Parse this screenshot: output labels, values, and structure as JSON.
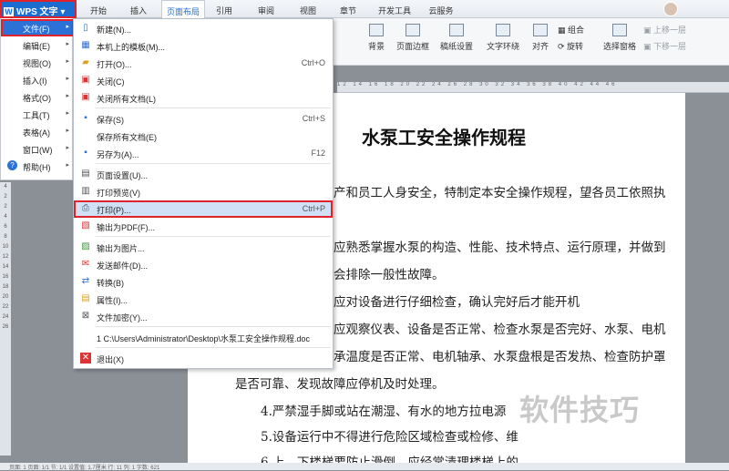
{
  "app": {
    "name": "WPS 文字"
  },
  "tabs": [
    "开始",
    "插入",
    "页面布局",
    "引用",
    "审阅",
    "视图",
    "章节",
    "开发工具",
    "云服务"
  ],
  "ribbon": {
    "big": [
      "背景",
      "页面边框",
      "稿纸设置",
      "文字环绕",
      "对齐",
      "旋转",
      "选择窗格"
    ],
    "small": [
      "组合",
      "上移一层",
      "下移一层"
    ]
  },
  "left_menu": [
    "文件(F)",
    "编辑(E)",
    "视图(O)",
    "插入(I)",
    "格式(O)",
    "工具(T)",
    "表格(A)",
    "窗口(W)",
    "帮助(H)"
  ],
  "file_menu": [
    {
      "label": "新建(N)...",
      "shortcut": "",
      "icon": "new-doc-icon"
    },
    {
      "label": "本机上的模板(M)...",
      "shortcut": "",
      "icon": "template-icon"
    },
    {
      "label": "打开(O)...",
      "shortcut": "Ctrl+O",
      "icon": "folder-open-icon"
    },
    {
      "label": "关闭(C)",
      "shortcut": "",
      "icon": "close-doc-icon"
    },
    {
      "label": "关闭所有文档(L)",
      "shortcut": "",
      "icon": "close-all-icon"
    },
    {
      "label": "保存(S)",
      "shortcut": "Ctrl+S",
      "icon": "save-icon"
    },
    {
      "label": "保存所有文档(E)",
      "shortcut": "",
      "icon": "save-all-icon"
    },
    {
      "label": "另存为(A)...",
      "shortcut": "F12",
      "icon": "save-as-icon"
    },
    {
      "label": "页面设置(U)...",
      "shortcut": "",
      "icon": "page-setup-icon"
    },
    {
      "label": "打印预览(V)",
      "shortcut": "",
      "icon": "print-preview-icon"
    },
    {
      "label": "打印(P)...",
      "shortcut": "Ctrl+P",
      "icon": "printer-icon"
    },
    {
      "label": "输出为PDF(F)...",
      "shortcut": "",
      "icon": "pdf-icon"
    },
    {
      "label": "输出为图片...",
      "shortcut": "",
      "icon": "image-export-icon"
    },
    {
      "label": "发送邮件(D)...",
      "shortcut": "",
      "icon": "mail-icon"
    },
    {
      "label": "转换(B)",
      "shortcut": "",
      "icon": "convert-icon"
    },
    {
      "label": "属性(I)...",
      "shortcut": "",
      "icon": "properties-icon"
    },
    {
      "label": "文件加密(Y)...",
      "shortcut": "",
      "icon": "encrypt-icon"
    },
    {
      "label": "1 C:\\Users\\Administrator\\Desktop\\水泵工安全操作规程.doc",
      "shortcut": "",
      "icon": ""
    },
    {
      "label": "退出(X)",
      "shortcut": "",
      "icon": "exit-icon"
    }
  ],
  "document": {
    "title": "水泵工安全操作规程",
    "lines": [
      "产和员工人身安全，特制定本安全操作规程，望各员工依照执",
      "应熟悉掌握水泵的构造、性能、技术特点、运行原理，并做到",
      "会排除一般性故障。",
      "应对设备进行仔细检查，确认完好后才能开机",
      "应观察仪表、设备是否正常、检查水泵是否完好、水泵、电机",
      "承温度是否正常、电机轴承、水泵盘根是否发热、检查防护罩",
      "是否可靠、发现故障应停机及时处理。",
      "4.严禁湿手脚或站在潮湿、有水的地方拉电源",
      "5.设备运行中不得进行危险区域检查或检修、维",
      "6.上、下楼梯要防止滑倒，应经常清理楼梯上的"
    ]
  },
  "ruler": "12 14 16 18 20 22 24 26 28 30 32 34 36 38 40 42 44 46",
  "vruler": [
    "4",
    "2",
    "2",
    "4",
    "6",
    "8",
    "10",
    "12",
    "14",
    "16",
    "18",
    "20",
    "22",
    "24",
    "26"
  ],
  "status": "页面: 1  页面: 1/1  节: 1/1  设置值: 1.7厘米  行: 11  列: 1  字数: 621",
  "watermark": "软件技巧",
  "colors": {
    "accent": "#1c6dd0",
    "highlight_border": "#e0222a"
  }
}
